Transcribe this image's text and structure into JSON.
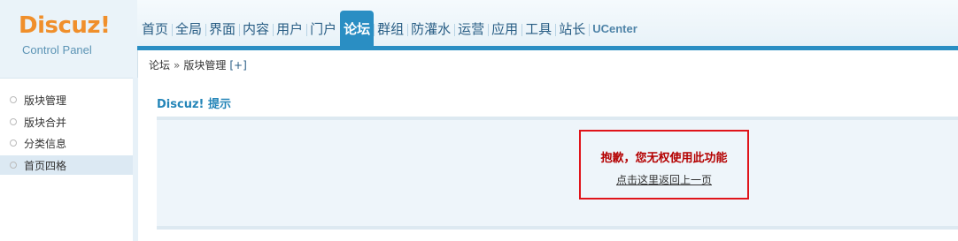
{
  "logo": {
    "title": "Discuz!",
    "subtitle": "Control Panel"
  },
  "nav": {
    "items": [
      "首页",
      "全局",
      "界面",
      "内容",
      "用户",
      "门户",
      "论坛",
      "群组",
      "防灌水",
      "运营",
      "应用",
      "工具",
      "站长",
      "UCenter"
    ],
    "active": "论坛"
  },
  "breadcrumb": {
    "section": "论坛",
    "separator": "»",
    "page": "版块管理",
    "add": "[+]"
  },
  "sidebar": {
    "items": [
      {
        "label": "版块管理"
      },
      {
        "label": "版块合并"
      },
      {
        "label": "分类信息"
      },
      {
        "label": "首页四格"
      }
    ],
    "active": "首页四格"
  },
  "main": {
    "title": "Discuz! 提示",
    "alert_text": "抱歉，您无权使用此功能",
    "back_link": "点击这里返回上一页"
  },
  "colors": {
    "accent": "#2a8ec3",
    "logo": "#f08f2b",
    "alert_border": "#e0141a",
    "alert_text": "#b40000"
  }
}
